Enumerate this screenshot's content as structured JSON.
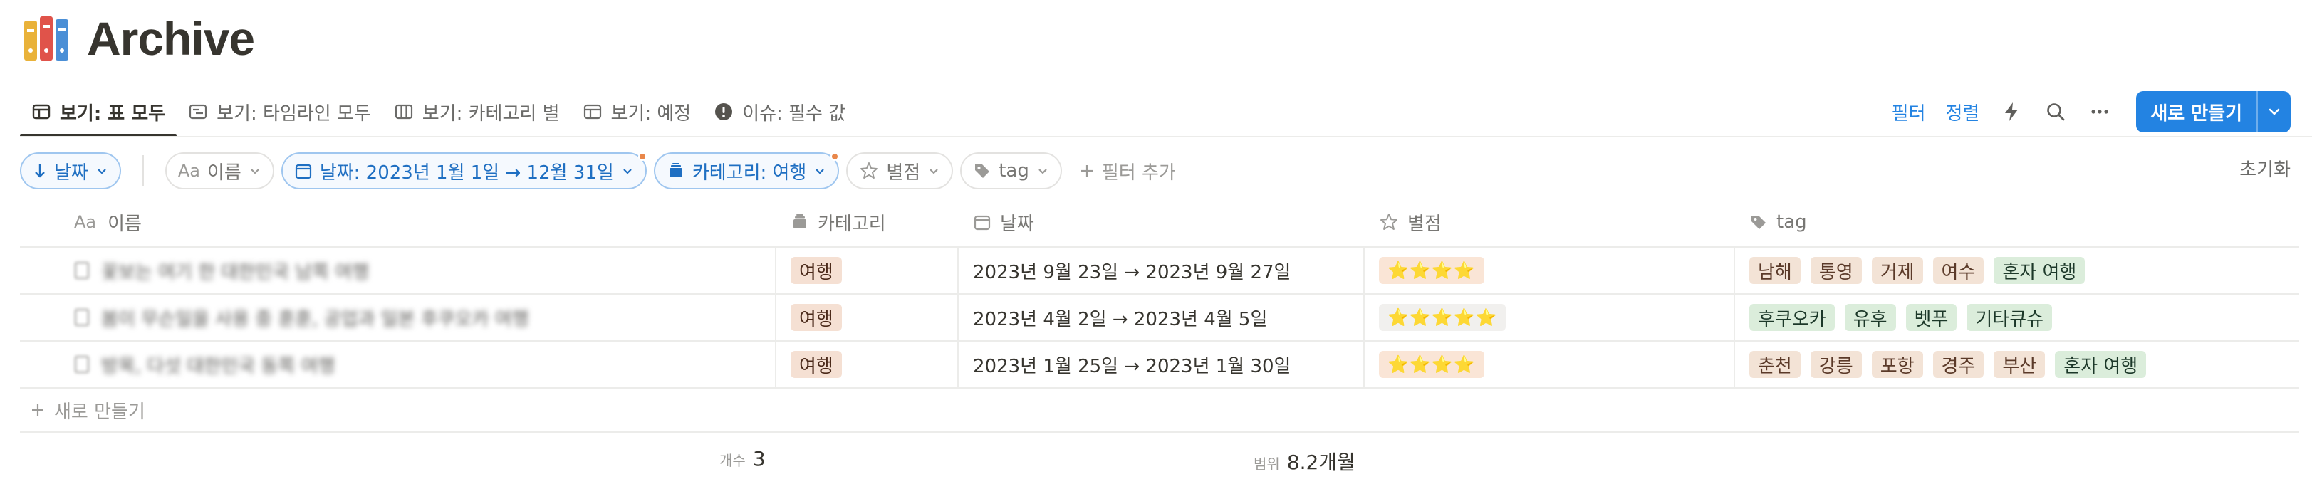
{
  "page": {
    "title": "Archive",
    "icon": "books-icon"
  },
  "tabs": [
    {
      "label": "보기: 표 모두",
      "icon": "table-icon",
      "active": true
    },
    {
      "label": "보기: 타임라인 모두",
      "icon": "timeline-icon",
      "active": false
    },
    {
      "label": "보기: 카테고리 별",
      "icon": "board-icon",
      "active": false
    },
    {
      "label": "보기: 예정",
      "icon": "table-icon",
      "active": false
    },
    {
      "label": "이슈: 필수 값",
      "icon": "alert-icon",
      "active": false
    }
  ],
  "actions": {
    "filter_label": "필터",
    "sort_label": "정렬",
    "new_label": "새로 만들기"
  },
  "filters": {
    "sort_chip": "날짜",
    "name_chip": "이름",
    "date_chip": "날짜: 2023년 1월 1일 → 12월 31일",
    "category_chip": "카테고리: 여행",
    "rating_chip": "별점",
    "tag_chip": "tag",
    "add_filter": "필터 추가",
    "reset": "초기화"
  },
  "table": {
    "columns": {
      "name": "이름",
      "category": "카테고리",
      "date": "날짜",
      "rating": "별점",
      "tag": "tag"
    },
    "rows": [
      {
        "name": "꽃보는 여기 한 대한민국 남쪽 여행",
        "category": "여행",
        "date": "2023년 9월 23일 → 2023년 9월 27일",
        "stars": "⭐⭐⭐⭐",
        "tags": [
          {
            "label": "남해",
            "color": "#f3e3d6"
          },
          {
            "label": "통영",
            "color": "#f3e3d6"
          },
          {
            "label": "거제",
            "color": "#f3e3d6"
          },
          {
            "label": "여수",
            "color": "#f3e3d6"
          },
          {
            "label": "혼자 여행",
            "color": "#dbeddb"
          }
        ]
      },
      {
        "name": "봄이 무슨일을 사용 중 훈훈, 공업과 일본 후쿠오카 여행",
        "category": "여행",
        "date": "2023년 4월 2일 → 2023년 4월 5일",
        "stars": "⭐⭐⭐⭐⭐",
        "tags": [
          {
            "label": "후쿠오카",
            "color": "#dbeddb"
          },
          {
            "label": "유후",
            "color": "#dbeddb"
          },
          {
            "label": "벳푸",
            "color": "#dbeddb"
          },
          {
            "label": "기타큐슈",
            "color": "#dbeddb"
          }
        ]
      },
      {
        "name": "방목, 다섯 대한민국 동쪽 여행",
        "category": "여행",
        "date": "2023년 1월 25일 → 2023년 1월 30일",
        "stars": "⭐⭐⭐⭐",
        "tags": [
          {
            "label": "춘천",
            "color": "#f3e3d6"
          },
          {
            "label": "강릉",
            "color": "#f3e3d6"
          },
          {
            "label": "포항",
            "color": "#f3e3d6"
          },
          {
            "label": "경주",
            "color": "#f3e3d6"
          },
          {
            "label": "부산",
            "color": "#f3e3d6"
          },
          {
            "label": "혼자 여행",
            "color": "#dbeddb"
          }
        ]
      }
    ],
    "new_row": "새로 만들기"
  },
  "footer": {
    "count_label": "개수",
    "count_value": "3",
    "range_label": "범위",
    "range_value": "8.2개월"
  },
  "colors": {
    "accent": "#2383e2",
    "text": "#37352f",
    "muted": "#787774"
  }
}
